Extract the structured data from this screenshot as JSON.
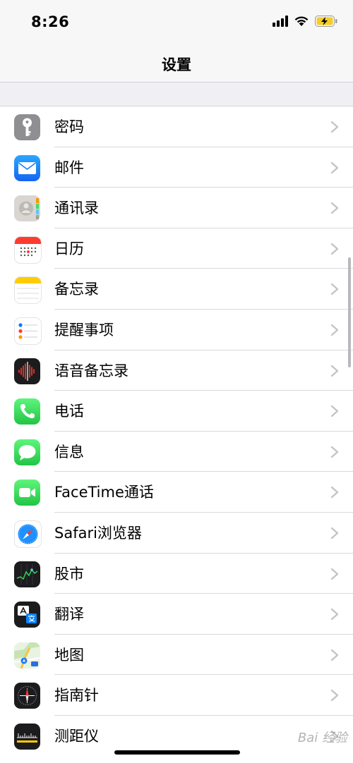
{
  "status_bar": {
    "time": "8:26",
    "icons": [
      "cellular-signal-icon",
      "wifi-icon",
      "battery-charging-icon"
    ]
  },
  "nav": {
    "title": "设置"
  },
  "rows": [
    {
      "label": "密码",
      "icon": "key-icon",
      "color": "#8e8e93"
    },
    {
      "label": "邮件",
      "icon": "mail-icon",
      "color": "#1a8cff"
    },
    {
      "label": "通讯录",
      "icon": "contacts-icon",
      "color": "#cfcfcf"
    },
    {
      "label": "日历",
      "icon": "calendar-icon",
      "color": "#ffffff"
    },
    {
      "label": "备忘录",
      "icon": "notes-icon",
      "color": "#ffffff"
    },
    {
      "label": "提醒事项",
      "icon": "reminders-icon",
      "color": "#ffffff"
    },
    {
      "label": "语音备忘录",
      "icon": "voice-memos-icon",
      "color": "#1c1c1e"
    },
    {
      "label": "电话",
      "icon": "phone-icon",
      "color": "#34c759"
    },
    {
      "label": "信息",
      "icon": "messages-icon",
      "color": "#34c759"
    },
    {
      "label": "FaceTime通话",
      "icon": "facetime-icon",
      "color": "#34c759"
    },
    {
      "label": "Safari浏览器",
      "icon": "safari-icon",
      "color": "#ffffff"
    },
    {
      "label": "股市",
      "icon": "stocks-icon",
      "color": "#1c1c1e"
    },
    {
      "label": "翻译",
      "icon": "translate-icon",
      "color": "#1c1c1e"
    },
    {
      "label": "地图",
      "icon": "maps-icon",
      "color": "#e8f3e0"
    },
    {
      "label": "指南针",
      "icon": "compass-icon",
      "color": "#1c1c1e"
    },
    {
      "label": "测距仪",
      "icon": "measure-icon",
      "color": "#1c1c1e"
    }
  ],
  "watermark": "Bai 经验"
}
